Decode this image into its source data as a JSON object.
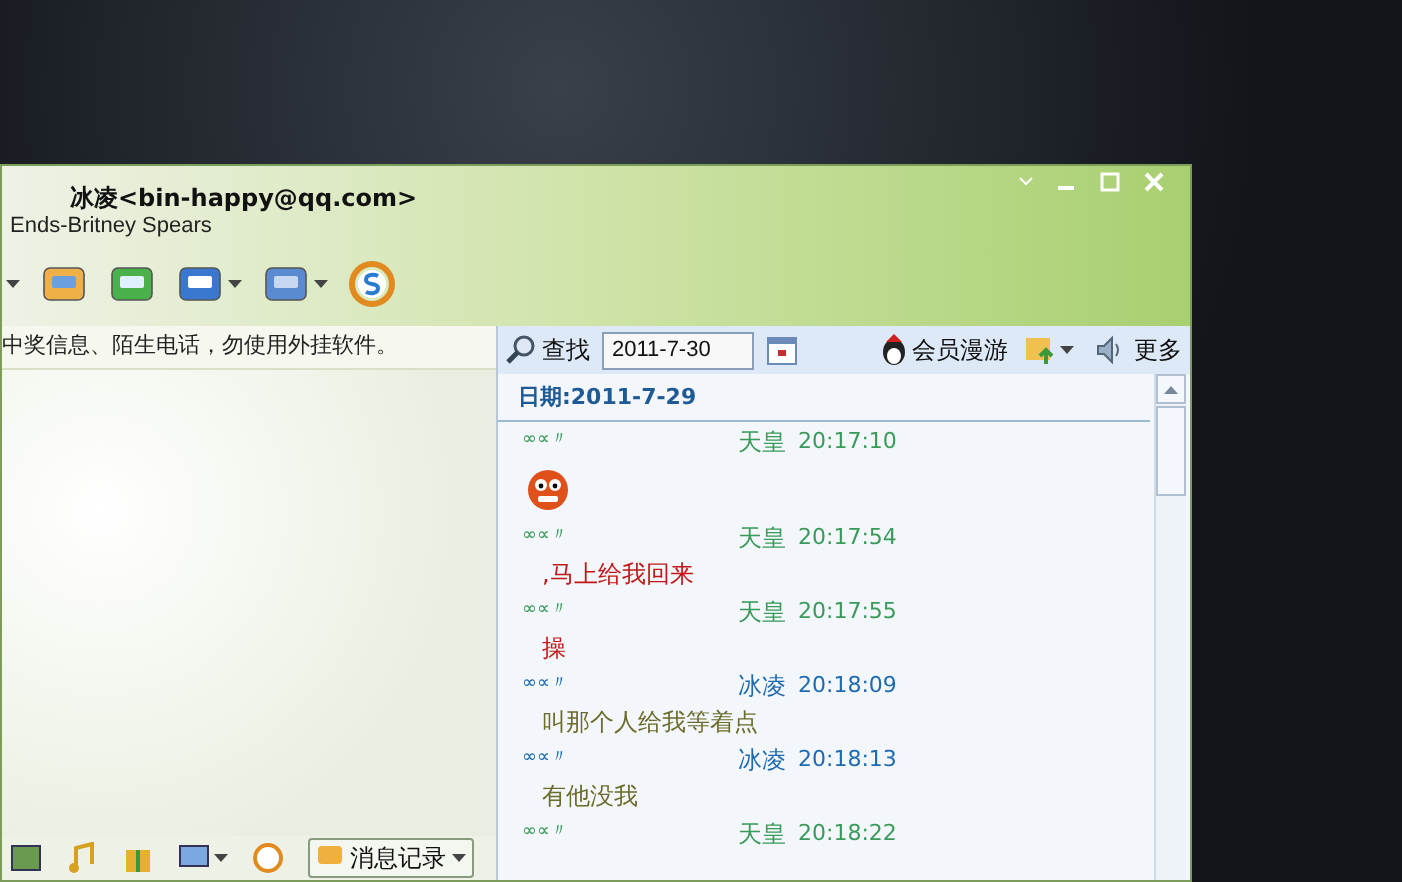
{
  "window": {
    "contact": "冰凌<bin-happy@qq.com>",
    "signature": "Ends-Britney Spears"
  },
  "notice": "中奖信息、陌生电话，勿使用外挂软件。",
  "history": {
    "search_label": "查找",
    "date_value": "2011-7-30",
    "member_label": "会员漫游",
    "more_label": "更多",
    "date_heading": "日期:2011-7-29",
    "messages": [
      {
        "kind": "emoji",
        "prefix": "∞∝〃",
        "sender": "天皇",
        "time": "20:17:10",
        "color": "#3a9a5a"
      },
      {
        "kind": "text",
        "prefix": "∞∝〃",
        "sender": "天皇",
        "time": "20:17:54",
        "color": "#3a9a5a",
        "body": {
          "text": ",马上给我回来",
          "color": "#c01818"
        }
      },
      {
        "kind": "text",
        "prefix": "∞∝〃",
        "sender": "天皇",
        "time": "20:17:55",
        "color": "#3a9a5a",
        "body": {
          "text": "操",
          "color": "#c01818"
        }
      },
      {
        "kind": "text",
        "prefix": "∞∝〃",
        "sender": "冰凌",
        "time": "20:18:09",
        "color": "#1e6ab0",
        "body": {
          "text": "叫那个人给我等着点",
          "color": "#6b6b2b"
        }
      },
      {
        "kind": "text",
        "prefix": "∞∝〃",
        "sender": "冰凌",
        "time": "20:18:13",
        "color": "#1e6ab0",
        "body": {
          "text": "有他没我",
          "color": "#6b6b2b"
        }
      },
      {
        "kind": "header",
        "prefix": "∞∝〃",
        "sender": "天皇",
        "time": "20:18:22",
        "color": "#3a9a5a"
      }
    ]
  },
  "bottom_toolbar": {
    "history_button": "消息记录"
  }
}
